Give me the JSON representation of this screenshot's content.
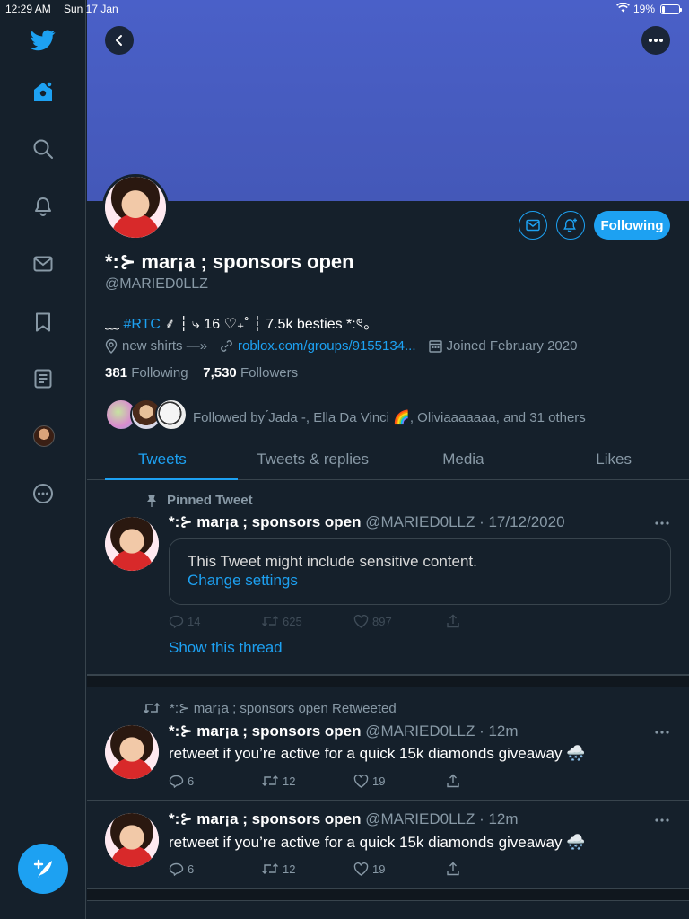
{
  "status_bar": {
    "time": "12:29 AM",
    "date": "Sun 17 Jan",
    "battery": "19%",
    "battery_level": 0.19
  },
  "sidebar": {
    "items": [
      {
        "name": "twitter-logo-icon"
      },
      {
        "name": "home-icon"
      },
      {
        "name": "explore-icon"
      },
      {
        "name": "notifications-icon"
      },
      {
        "name": "messages-icon"
      },
      {
        "name": "bookmarks-icon"
      },
      {
        "name": "lists-icon"
      },
      {
        "name": "profile-avatar"
      },
      {
        "name": "more-icon"
      }
    ],
    "accent": "#1da1f2"
  },
  "profile": {
    "display_name": "*:⊱ mar¡a ; sponsors open",
    "handle": "@MARIED0LLZ",
    "bio_prefix": "﹏ ",
    "bio_tag": "#RTC",
    "bio_rest": " ⸙ ┆ ⤷ 16 ♡₊˚ ┆ 7.5k besties *:ৎ。",
    "location": "new shirts —»",
    "website": "roblox.com/groups/9155134...",
    "joined": "Joined February 2020",
    "following_count": "381",
    "following_label": " Following",
    "followers_count": "7,530",
    "followers_label": " Followers",
    "followed_by": "Followed by ́Jada -, Ella Da Vinci 🌈, Oliviaaaaaaa, and 31 others",
    "following_button": "Following"
  },
  "tabs": [
    {
      "label": "Tweets",
      "active": true
    },
    {
      "label": "Tweets & replies",
      "active": false
    },
    {
      "label": "Media",
      "active": false
    },
    {
      "label": "Likes",
      "active": false
    }
  ],
  "tweets": [
    {
      "context": "Pinned Tweet",
      "name": "*:⊱ mar¡a ; sponsors open",
      "handle_time": " @MARIED0LLZ · 17/12/2020",
      "sensitive_text": "This Tweet might include sensitive content.",
      "change_settings": "Change settings",
      "replies": "14",
      "retweets": "625",
      "likes": "897",
      "show_thread": "Show this thread"
    },
    {
      "context": "*:⊱ mar¡a ; sponsors open Retweeted",
      "name": "*:⊱ mar¡a ; sponsors open",
      "handle_time": " @MARIED0LLZ · 12m",
      "text": "retweet if you’re active for a quick 15k diamonds giveaway 🌨️",
      "replies": "6",
      "retweets": "12",
      "likes": "19"
    },
    {
      "name": "*:⊱ mar¡a ; sponsors open",
      "handle_time": " @MARIED0LLZ · 12m",
      "text": "retweet if you’re active for a quick 15k diamonds giveaway 🌨️",
      "replies": "6",
      "retweets": "12",
      "likes": "19"
    }
  ]
}
